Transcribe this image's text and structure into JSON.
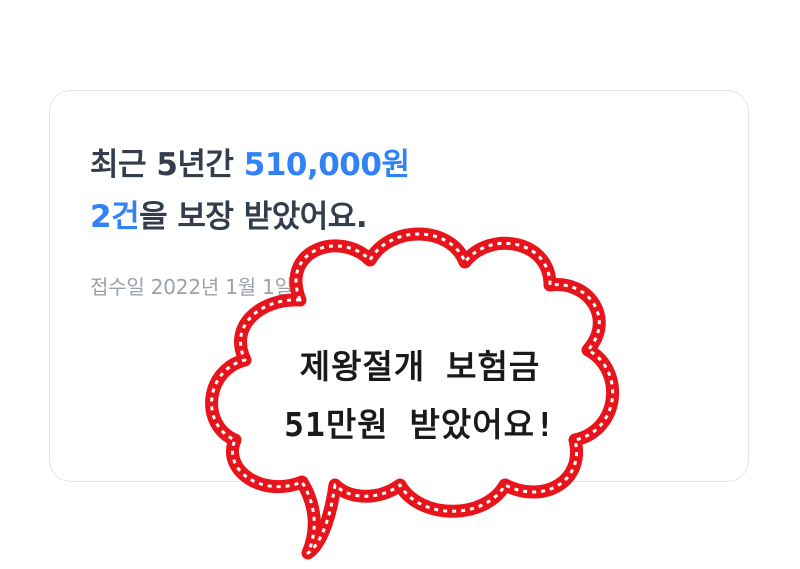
{
  "card": {
    "line1_prefix": "최근 5년간 ",
    "line1_amount": "510,000원",
    "line2_count": "2건",
    "line2_suffix": "을 보장 받았어요.",
    "period": "접수일 2022년 1월 1일 ~ 2026년 8월 1일"
  },
  "bubble": {
    "line1": "제왕절개 보험금",
    "line2": "51만원 받았어요!"
  },
  "colors": {
    "accent": "#3182f6",
    "text_primary": "#333d4b",
    "text_secondary": "#9ba1a8",
    "bubble_outline": "#e8141c"
  }
}
